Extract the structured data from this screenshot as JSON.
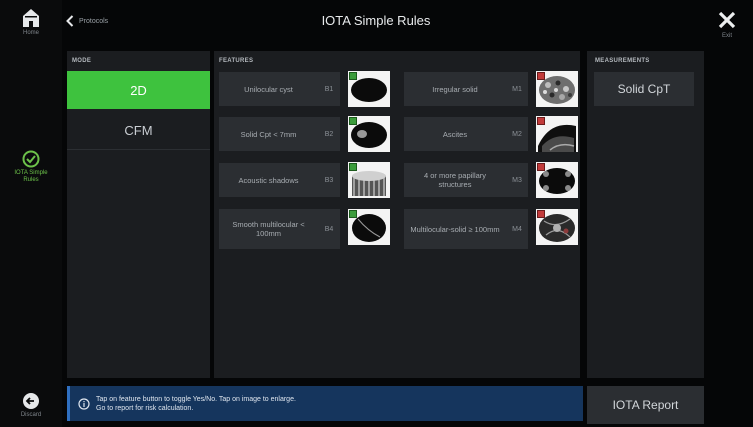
{
  "left_rail": {
    "home_label": "Home",
    "iota_label": "IOTA Simple Rules",
    "discard_label": "Discard"
  },
  "topbar": {
    "back_label": "Protocols",
    "title": "IOTA Simple Rules",
    "exit_label": "Exit"
  },
  "mode": {
    "header": "MODE",
    "options": [
      "2D",
      "CFM"
    ],
    "selected": "2D"
  },
  "features": {
    "header": "FEATURES",
    "benign": [
      {
        "label": "Unilocular cyst",
        "code": "B1"
      },
      {
        "label": "Solid Cpt < 7mm",
        "code": "B2"
      },
      {
        "label": "Acoustic shadows",
        "code": "B3"
      },
      {
        "label": "Smooth multilocular < 100mm",
        "code": "B4"
      }
    ],
    "malignant": [
      {
        "label": "Irregular solid",
        "code": "M1"
      },
      {
        "label": "Ascites",
        "code": "M2"
      },
      {
        "label": "4 or more papillary structures",
        "code": "M3"
      },
      {
        "label": "Multilocular-solid ≥ 100mm",
        "code": "M4"
      }
    ]
  },
  "measurements": {
    "header": "MEASUREMENTS",
    "button_label": "Solid CpT"
  },
  "info": {
    "line1": "Tap on feature button to toggle Yes/No. Tap on image to enlarge.",
    "line2": "Go to report for risk calculation."
  },
  "report_button": "IOTA Report",
  "colors": {
    "accent_green": "#3ec23e",
    "info_blue": "#15355d",
    "benign_marker": "#3b9c3b",
    "malignant_marker": "#c23b3b"
  }
}
